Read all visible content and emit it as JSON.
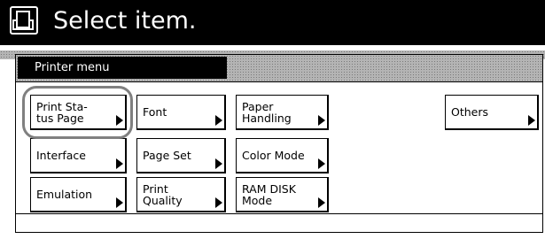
{
  "header": {
    "title": "Select item.",
    "icon": "page-icon"
  },
  "menu": {
    "title": "Printer menu"
  },
  "buttons": {
    "print_status_page": "Print Sta-\ntus Page",
    "font": "Font",
    "paper_handling": "Paper\nHandling",
    "others": "Others",
    "interface": "Interface",
    "page_set": "Page Set",
    "color_mode": "Color Mode",
    "emulation": "Emulation",
    "print_quality": "Print\nQuality",
    "ram_disk_mode": "RAM DISK\nMode"
  },
  "colors": {
    "header_bg": "#000000",
    "highlight_ring": "#808080"
  }
}
